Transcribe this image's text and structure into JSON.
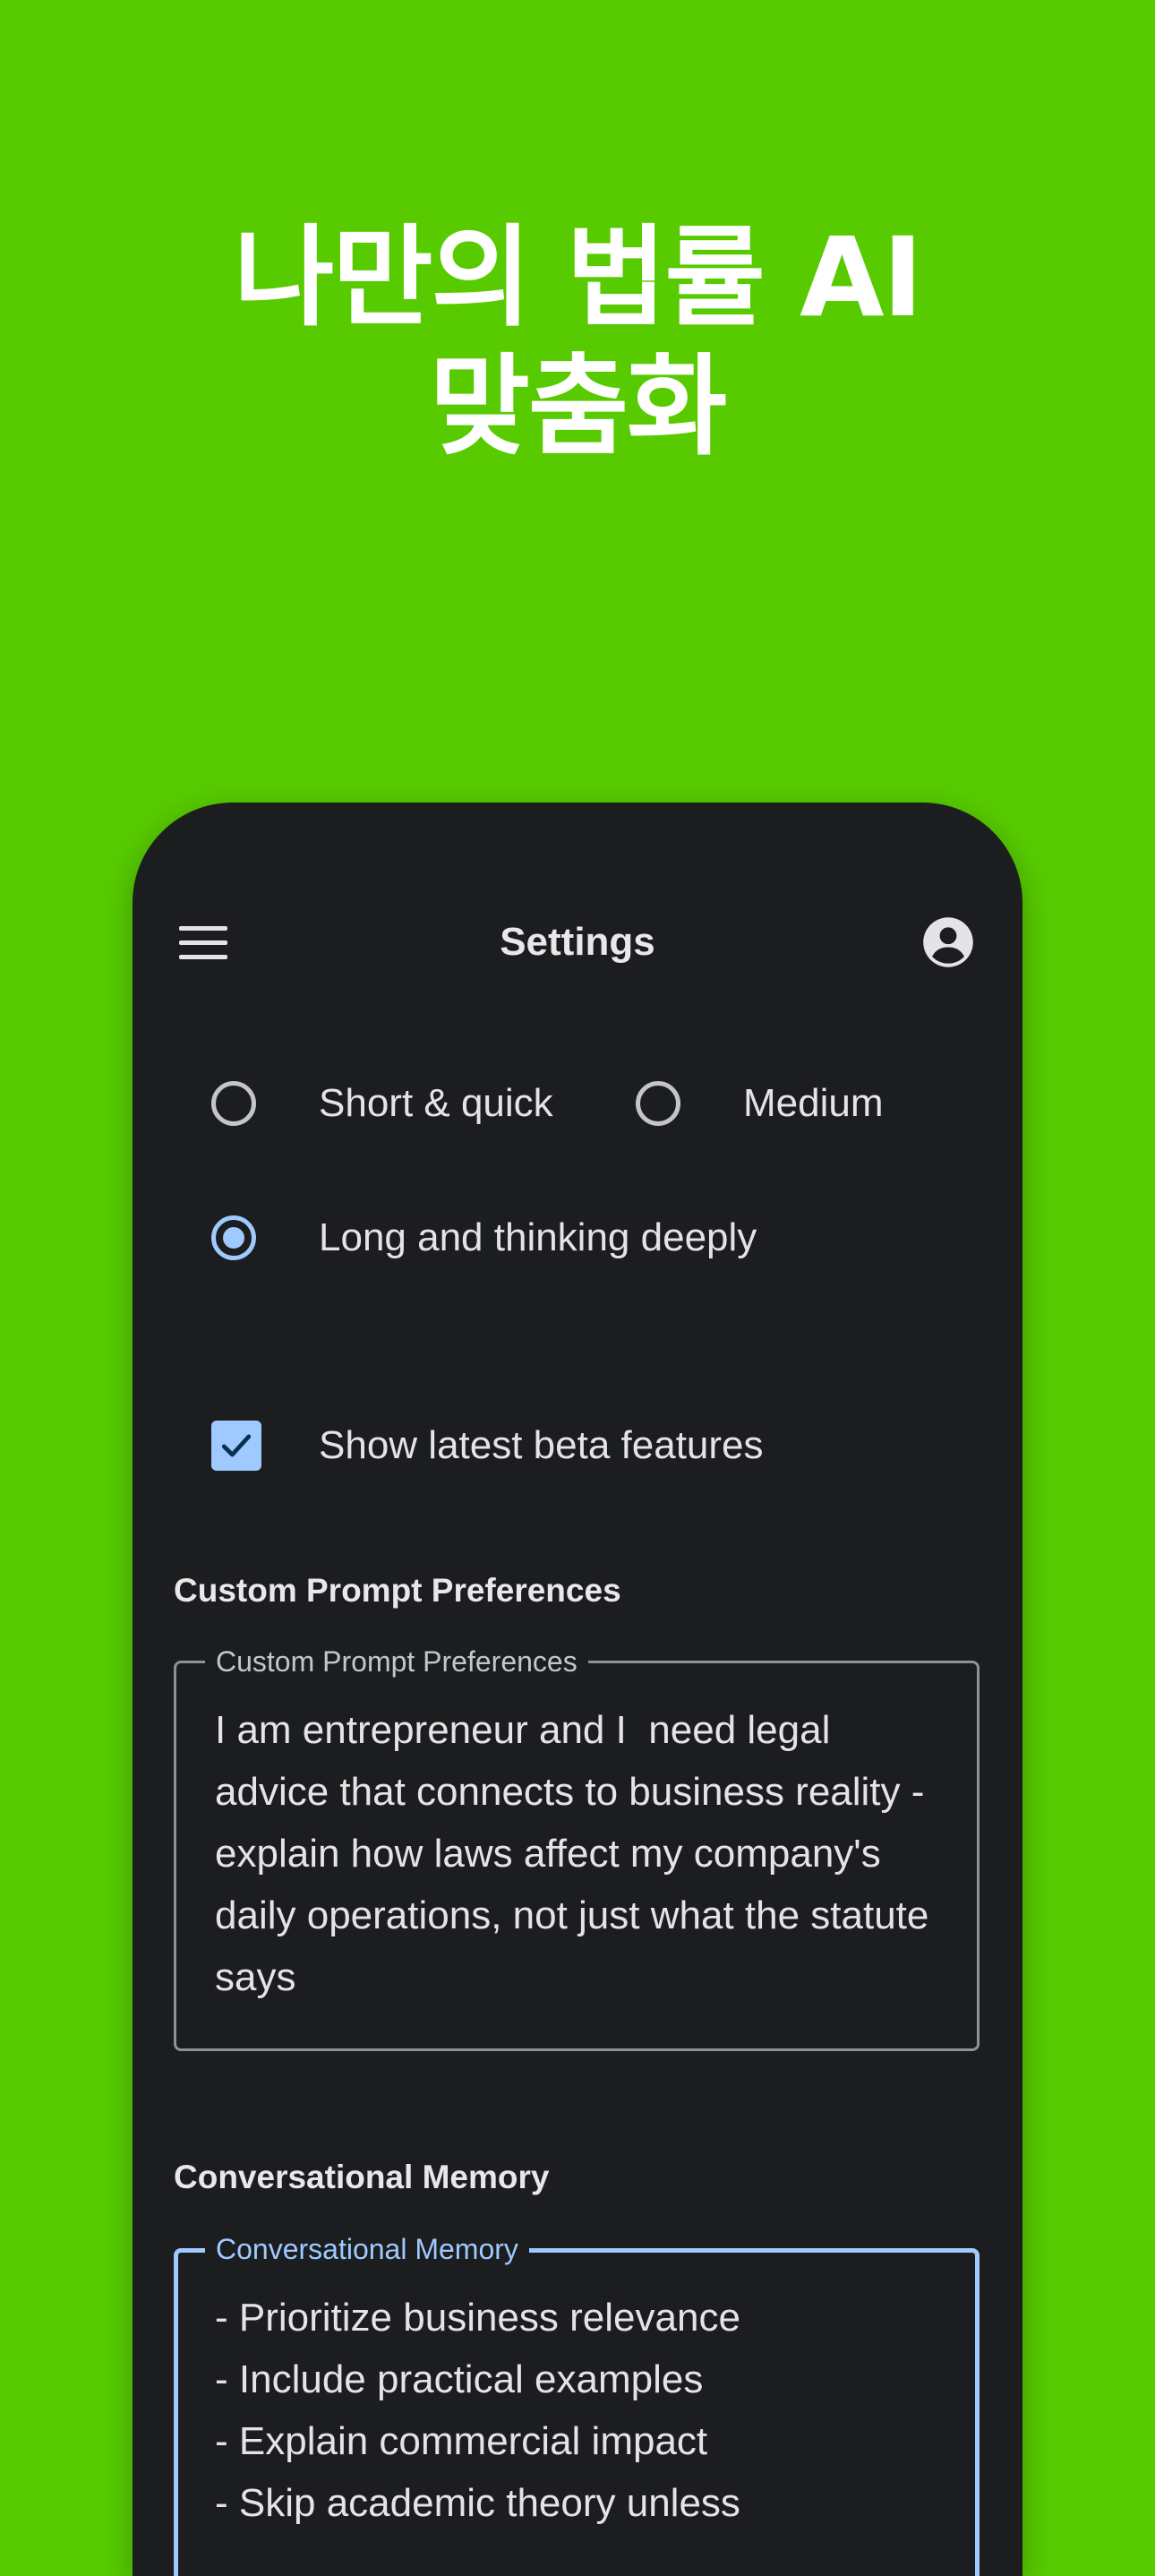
{
  "headline": {
    "line1": "나만의 법률 AI",
    "line2": "맞춤화"
  },
  "appbar": {
    "title": "Settings",
    "menu_icon": "hamburger-menu-icon",
    "account_icon": "account-circle-icon"
  },
  "response_length": {
    "selected": "Long and thinking deeply",
    "options": [
      {
        "label": "Short & quick",
        "checked": false
      },
      {
        "label": "Medium",
        "checked": false
      },
      {
        "label": "Long and thinking deeply",
        "checked": true
      }
    ]
  },
  "beta": {
    "label": "Show latest beta features",
    "checked": true
  },
  "custom_prompt": {
    "heading": "Custom Prompt Preferences",
    "label": "Custom Prompt Preferences",
    "value": "I am entrepreneur and I  need legal advice that connects to business reality - explain how laws affect my company's daily operations, not just what the statute says"
  },
  "memory": {
    "heading": "Conversational Memory",
    "label": "Conversational Memory",
    "value": "- Prioritize business relevance\n- Include practical examples\n- Explain commercial impact\n- Skip academic theory unless"
  },
  "colors": {
    "background": "#57cb00",
    "surface": "#1c1d1f",
    "accent": "#9ecaff",
    "outline": "#8d9199",
    "text": "#e4e4e6"
  }
}
